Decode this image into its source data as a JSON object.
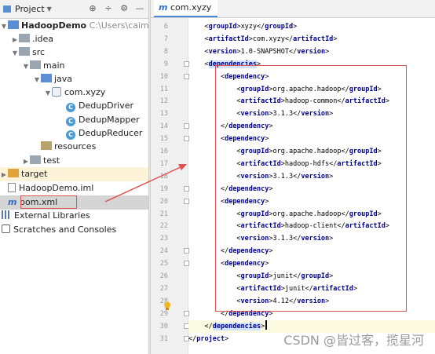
{
  "project": {
    "title": "Project",
    "header_icons": [
      "target-icon",
      "collapse-all-icon",
      "settings-icon",
      "hide-icon"
    ],
    "tree": [
      {
        "label": "HadoopDemo",
        "path": "C:\\Users\\caimin\\Ide",
        "icon": "folder"
      },
      {
        "label": ".idea",
        "icon": "folder"
      },
      {
        "label": "src",
        "icon": "folder"
      },
      {
        "label": "main",
        "icon": "folder"
      },
      {
        "label": "java",
        "icon": "folder"
      },
      {
        "label": "com.xyzy",
        "icon": "package"
      },
      {
        "label": "DedupDriver",
        "icon": "class"
      },
      {
        "label": "DedupMapper",
        "icon": "class"
      },
      {
        "label": "DedupReducer",
        "icon": "class"
      },
      {
        "label": "resources",
        "icon": "folder"
      },
      {
        "label": "test",
        "icon": "folder"
      },
      {
        "label": "target",
        "icon": "folder"
      },
      {
        "label": "HadoopDemo.iml",
        "icon": "file"
      },
      {
        "label": "pom.xml",
        "icon": "maven"
      },
      {
        "label": "External Libraries",
        "icon": "library"
      },
      {
        "label": "Scratches and Consoles",
        "icon": "scratches"
      }
    ]
  },
  "editor": {
    "tab_label": "com.xyzy",
    "lines": [
      {
        "n": "6",
        "pre": "    ",
        "open": "groupId",
        "text": "xyzy",
        "close": "groupId"
      },
      {
        "n": "7",
        "pre": "    ",
        "open": "artifactId",
        "text": "com.xyzy",
        "close": "artifactId"
      },
      {
        "n": "8",
        "pre": "    ",
        "open": "version",
        "text": "1.0-SNAPSHOT",
        "close": "version"
      },
      {
        "n": "9",
        "pre": "    ",
        "open": "dependencies",
        "text": "",
        "close": ""
      },
      {
        "n": "10",
        "pre": "        ",
        "open": "dependency",
        "text": "",
        "close": ""
      },
      {
        "n": "11",
        "pre": "            ",
        "open": "groupId",
        "text": "org.apache.hadoop",
        "close": "groupId"
      },
      {
        "n": "12",
        "pre": "            ",
        "open": "artifactId",
        "text": "hadoop-common",
        "close": "artifactId"
      },
      {
        "n": "13",
        "pre": "            ",
        "open": "version",
        "text": "3.1.3",
        "close": "version"
      },
      {
        "n": "14",
        "pre": "        ",
        "open": "",
        "text": "",
        "close": "dependency"
      },
      {
        "n": "15",
        "pre": "        ",
        "open": "dependency",
        "text": "",
        "close": ""
      },
      {
        "n": "16",
        "pre": "            ",
        "open": "groupId",
        "text": "org.apache.hadoop",
        "close": "groupId"
      },
      {
        "n": "17",
        "pre": "            ",
        "open": "artifactId",
        "text": "hadoop-hdfs",
        "close": "artifactId"
      },
      {
        "n": "18",
        "pre": "            ",
        "open": "version",
        "text": "3.1.3",
        "close": "version"
      },
      {
        "n": "19",
        "pre": "        ",
        "open": "",
        "text": "",
        "close": "dependency"
      },
      {
        "n": "20",
        "pre": "        ",
        "open": "dependency",
        "text": "",
        "close": ""
      },
      {
        "n": "21",
        "pre": "            ",
        "open": "groupId",
        "text": "org.apache.hadoop",
        "close": "groupId"
      },
      {
        "n": "22",
        "pre": "            ",
        "open": "artifactId",
        "text": "hadoop-client",
        "close": "artifactId"
      },
      {
        "n": "23",
        "pre": "            ",
        "open": "version",
        "text": "3.1.3",
        "close": "version"
      },
      {
        "n": "24",
        "pre": "        ",
        "open": "",
        "text": "",
        "close": "dependency"
      },
      {
        "n": "25",
        "pre": "        ",
        "open": "dependency",
        "text": "",
        "close": ""
      },
      {
        "n": "26",
        "pre": "            ",
        "open": "groupId",
        "text": "junit",
        "close": "groupId"
      },
      {
        "n": "27",
        "pre": "            ",
        "open": "artifactId",
        "text": "junit",
        "close": "artifactId"
      },
      {
        "n": "28",
        "pre": "            ",
        "open": "version",
        "text": "4.12",
        "close": "version"
      },
      {
        "n": "29",
        "pre": "        ",
        "open": "",
        "text": "",
        "close": "dependency"
      },
      {
        "n": "30",
        "pre": "    ",
        "open": "",
        "text": "",
        "close": "dependencies"
      },
      {
        "n": "31",
        "pre": "",
        "open": "",
        "text": "",
        "close": "project"
      }
    ]
  },
  "watermark": "CSDN @皆过客，揽星河",
  "colors": {
    "tag": "#00008a",
    "annotation": "#e05252",
    "selection": "#d5d5d5",
    "tab_accent": "#4a8ad8"
  }
}
